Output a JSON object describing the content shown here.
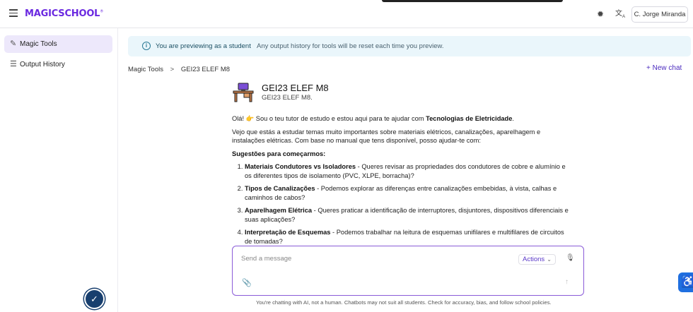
{
  "header": {
    "logo_text": "MAGICSCHOOL",
    "logo_mark": "®",
    "user_label": "C. Jorge Miranda",
    "icons": [
      "menu-icon",
      "theme-icon",
      "translate-icon"
    ]
  },
  "sidebar": {
    "items": [
      {
        "label": "Magic Tools",
        "icon": "magic-wand-icon",
        "active": true
      },
      {
        "label": "Output History",
        "icon": "history-list-icon",
        "active": false
      }
    ]
  },
  "banner": {
    "title": "You are previewing as a student",
    "subtitle": "Any output history for tools will be reset each time you preview."
  },
  "breadcrumb": {
    "root": "Magic Tools",
    "separator": ">",
    "current": "GEI23 ELEF M8"
  },
  "new_chat_label": "New chat",
  "tool": {
    "title": "GEI23 ELEF M8",
    "subtitle": "GEI23 ELEF M8."
  },
  "message": {
    "greeting_start": "Olá! 👉 Sou o teu tutor de estudo e estou aqui para te ajudar com ",
    "greeting_topic": "Tecnologias de Eletricidade",
    "greeting_end": ".",
    "intro": "Vejo que estás a estudar temas muito importantes sobre materiais elétricos, canalizações, aparelhagem e instalações elétricas. Com base no manual que tens disponível, posso ajudar-te com:",
    "suggestions_heading": "Sugestões para começarmos:",
    "items": [
      {
        "title": "Materiais Condutores vs Isoladores",
        "text": " - Queres revisar as propriedades dos condutores de cobre e alumínio e os diferentes tipos de isolamento (PVC, XLPE, borracha)?"
      },
      {
        "title": "Tipos de Canalizações",
        "text": " - Podemos explorar as diferenças entre canalizações embebidas, à vista, calhas e caminhos de cabos?"
      },
      {
        "title": "Aparelhagem Elétrica",
        "text": " - Queres praticar a identificação de interruptores, disjuntores, dispositivos diferenciais e suas aplicações?"
      },
      {
        "title": "Interpretação de Esquemas",
        "text": " - Podemos trabalhar na leitura de esquemas unifilares e multifilares de circuitos de tomadas?"
      }
    ]
  },
  "composer": {
    "placeholder": "Send a message",
    "actions_label": "Actions"
  },
  "disclaimer": "You're chatting with AI, not a human. Chatbots may not suit all students. Check for accuracy, bias, and follow school policies.",
  "colors": {
    "brand": "#6a28e0",
    "accent": "#8a5bd8",
    "banner_bg": "#eaf6fb",
    "active_nav_bg": "#ede8fb",
    "accessibility": "#1f6fe0"
  }
}
